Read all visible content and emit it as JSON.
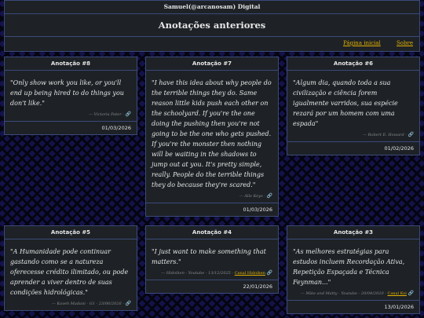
{
  "header": {
    "site_title": "Samuel(@arcanosam) Digital",
    "page_title": "Anotações anteriores",
    "nav": [
      "Página inicial",
      "Sobre"
    ]
  },
  "cards": [
    {
      "title": "Anotação #8",
      "quote": "\"Only show work you like, or you'll end up being hired to do things you don't like.\"",
      "attribution": "— Victoria Pater -",
      "source_link": "",
      "date": "01/03/2026"
    },
    {
      "title": "Anotação #7",
      "quote": "\"I have this idea about why people do the terrible things they do. Same reason little kids push each other on the schoolyard. If you're the one doing the pushing then you're not going to be the one who gets pushed. If you're the monster then nothing will be waiting in the shadows to jump out at you. It's pretty simple, really. People do the terrible things they do because they're scared.\"",
      "attribution": "— Alle Keys -",
      "source_link": "",
      "date": "01/03/2026"
    },
    {
      "title": "Anotação #6",
      "quote": "\"Algum dia, quando toda a sua civilização e ciência forem igualmente varridos, sua espécie rezará por um homem com uma espada\"",
      "attribution": "— Robert E. Howard -",
      "source_link": "",
      "date": "01/02/2026"
    },
    {
      "title": "Anotação #5",
      "quote": "\"A Humanidade pode continuar gastando como se a natureza oferecesse crédito ilimitado, ou pode aprender a viver dentro de suas condições hidrológicas.\"",
      "attribution": "— Kaveh Madani - G1 - 23/06/2026 -",
      "source_link": "",
      "date": ""
    },
    {
      "title": "Anotação #4",
      "quote": "\"I just want to make something that matters.\"",
      "attribution": "— Hidoiken - Youtube - 13/12/2025 -",
      "source_link": "Canal Hidoiken",
      "date": "22/01/2026"
    },
    {
      "title": "Anotação #3",
      "quote": "\"As melhores estratégias para estudos incluem Recordação Ativa, Repetição Espaçada e Técnica Feynman...\"",
      "attribution": "— Mike and Matty - Youtube - 20/04/2020 -",
      "source_link": "Canal Koi",
      "date": "13/01/2026"
    }
  ],
  "icons": {
    "link": "link-icon"
  },
  "colors": {
    "accent": "#e0b000",
    "panel": "#1e2226",
    "border": "#3a4a7a"
  }
}
